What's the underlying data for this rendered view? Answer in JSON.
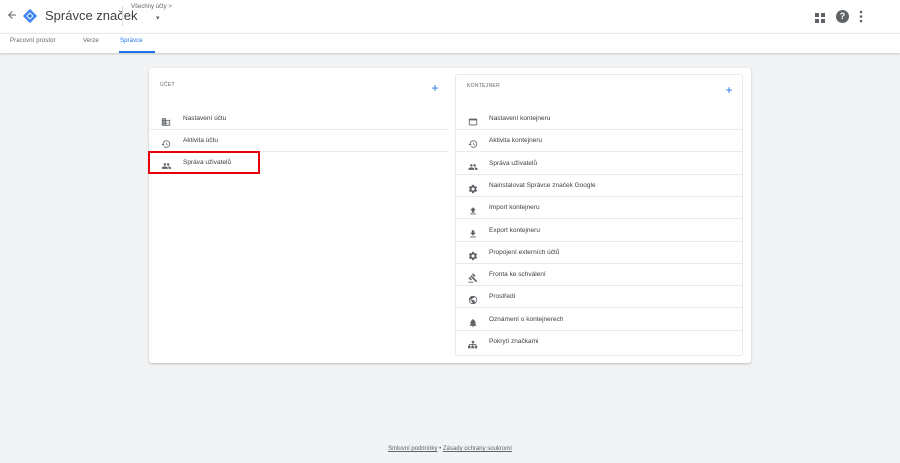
{
  "header": {
    "back_icon": "arrow-back-icon",
    "logo_icon": "tag-manager-logo",
    "app_title": "Správce značek",
    "account_label": "Všechny účty >",
    "account_caret": "▾",
    "help_label": "?",
    "more_label": "⋮"
  },
  "tabs": [
    {
      "label": "Pracovní prostor",
      "active": false
    },
    {
      "label": "Verze",
      "active": false
    },
    {
      "label": "Správce",
      "active": true
    }
  ],
  "account_section": {
    "title": "ÚČET",
    "add_label": "+",
    "items": [
      {
        "label": "Nastavení účtu",
        "icon": "building-icon"
      },
      {
        "label": "Aktivita účtu",
        "icon": "history-icon"
      },
      {
        "label": "Správa uživatelů",
        "icon": "people-icon"
      }
    ]
  },
  "container_section": {
    "title": "KONTEJNER",
    "add_label": "+",
    "items": [
      {
        "label": "Nastavení kontejneru",
        "icon": "window-icon"
      },
      {
        "label": "Aktivita kontejneru",
        "icon": "history-icon"
      },
      {
        "label": "Správa uživatelů",
        "icon": "people-icon"
      },
      {
        "label": "Nainstalovat Správce značek Google",
        "icon": "gear-icon"
      },
      {
        "label": "Import kontejneru",
        "icon": "upload-icon"
      },
      {
        "label": "Export kontejneru",
        "icon": "download-icon"
      },
      {
        "label": "Propojení externích účtů",
        "icon": "gear-icon"
      },
      {
        "label": "Fronta ke schválení",
        "icon": "gavel-icon"
      },
      {
        "label": "Prostředí",
        "icon": "globe-icon"
      },
      {
        "label": "Oznámení o kontejnerech",
        "icon": "bell-icon"
      },
      {
        "label": "Pokrytí značkami",
        "icon": "sitemap-icon"
      }
    ]
  },
  "footer": {
    "terms": "Smluvní podmínky",
    "separator": "•",
    "privacy": "Zásady ochrany soukromí"
  },
  "colors": {
    "accent": "#1a73e8",
    "highlight": "#e8000b",
    "background": "#f1f3f4"
  }
}
